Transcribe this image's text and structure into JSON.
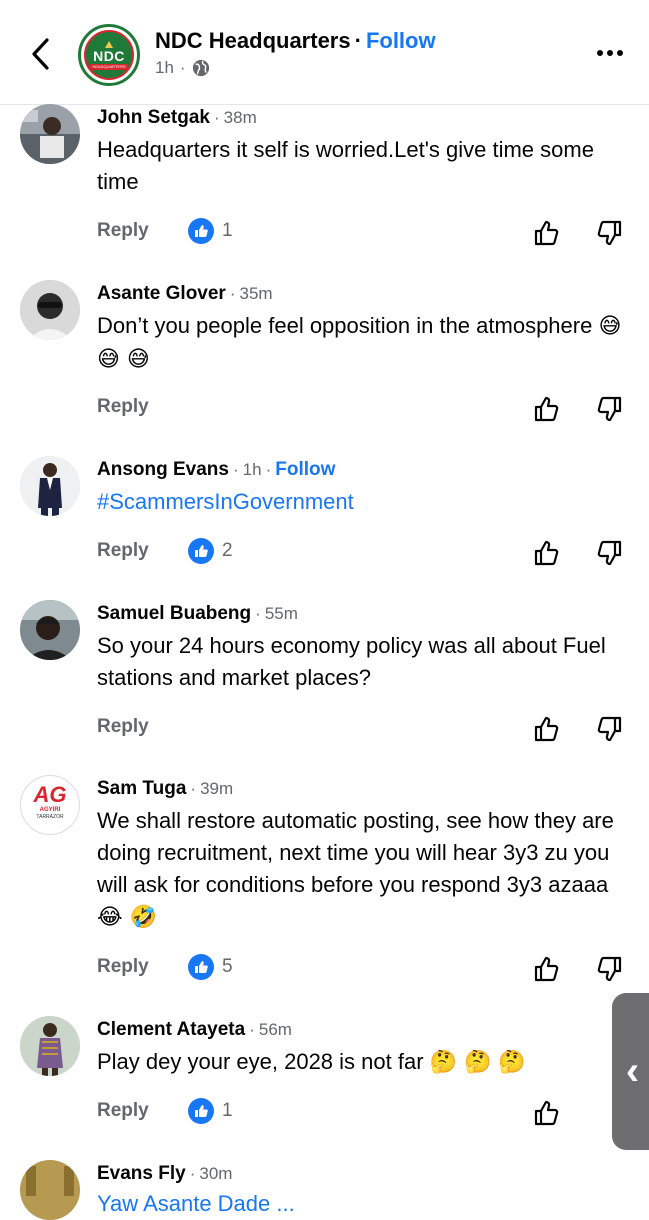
{
  "header": {
    "page_name": "NDC Headquarters",
    "dot": "·",
    "follow_label": "Follow",
    "time": "1h",
    "avatar_big": "NDC",
    "avatar_small": "HEADQUARTERS",
    "more_icon": "more-horizontal-icon",
    "back_icon": "chevron-left-icon",
    "globe_icon": "globe-icon"
  },
  "comments": [
    {
      "author": "John Setgak",
      "time": "38m",
      "text": "Headquarters it self is worried.Let's give time some time",
      "reply": "Reply",
      "likes": "1"
    },
    {
      "author": "Asante Glover",
      "time": "35m",
      "text": "Don’t you people feel opposition in the atmosphere",
      "emoji": "😅 😅 😅",
      "reply": "Reply"
    },
    {
      "author": "Ansong Evans",
      "time": "1h",
      "follow": "Follow",
      "text": "#ScammersInGovernment",
      "reply": "Reply",
      "likes": "2"
    },
    {
      "author": "Samuel Buabeng",
      "time": "55m",
      "text": "So your 24 hours economy policy was all about Fuel stations and market places?",
      "reply": "Reply"
    },
    {
      "author": "Sam Tuga",
      "time": "39m",
      "text": "We shall restore automatic posting, see how they are doing recruitment, next time you will hear 3y3 zu you will ask for conditions before you respond 3y3 azaaa",
      "emoji": "😂 🤣",
      "reply": "Reply",
      "likes": "5",
      "avatar_logo": "AG",
      "avatar_line1": "AGYIRI",
      "avatar_line2": "TARRAZOR"
    },
    {
      "author": "Clement Atayeta",
      "time": "56m",
      "text": "Play dey your eye, 2028 is not far",
      "emoji": "🤔 🤔 🤔",
      "reply": "Reply",
      "likes": "1"
    },
    {
      "author": "Evans Fly",
      "time": "30m",
      "text": "Yaw Asante Dade ..."
    }
  ],
  "side_handle_glyph": "‹",
  "colors": {
    "accent": "#1877f2",
    "meta": "#65676b",
    "text": "#050505"
  }
}
